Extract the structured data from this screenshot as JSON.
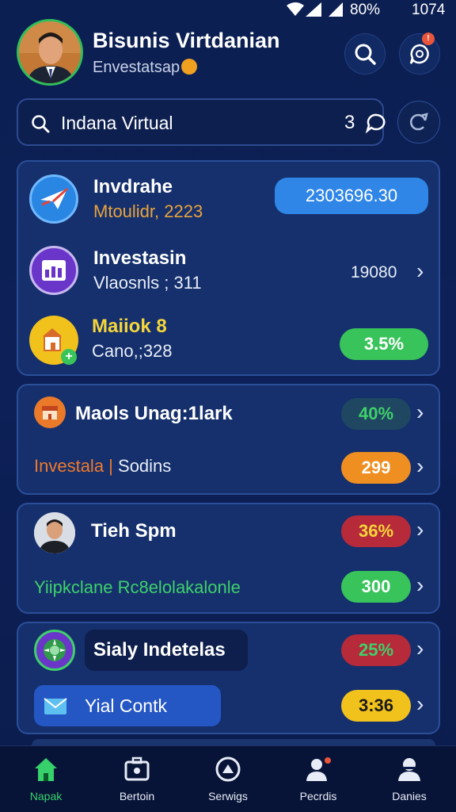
{
  "status_bar": {
    "battery": "80%",
    "time": "1074"
  },
  "header": {
    "title": "Bisunis Virtdanian",
    "subtitle": "Envestatsap",
    "notification_count": "!"
  },
  "search": {
    "text": "Indana Virtual",
    "count": "3"
  },
  "card1": {
    "rows": [
      {
        "title": "Invdrahe",
        "subtitle": "Mtoulidr, 2223",
        "value": "2303696.30",
        "icon": "paper-plane-icon"
      },
      {
        "title": "Investasin",
        "subtitle": "Vlaosnls ; 311",
        "value": "19080",
        "icon": "chart-icon"
      },
      {
        "title": "Maiiok 8",
        "subtitle": "Cano,;328",
        "value": "3.5%",
        "icon": "building-icon"
      }
    ]
  },
  "card2": {
    "title": "Maols Unag:1lark",
    "badge": "40%",
    "sub_orange": "Investala",
    "sub_white": "Sodins",
    "value": "299"
  },
  "card3": {
    "title": "Tieh Spm",
    "badge": "36%",
    "subtitle": "Yiipkclane Rc8elolakalonle",
    "value": "300"
  },
  "card4": {
    "title": "Sialy Indetelas",
    "badge": "25%",
    "button_label": "Yial Contk",
    "value": "3:36"
  },
  "nav": [
    {
      "label": "Napak",
      "icon": "home-icon",
      "active": true
    },
    {
      "label": "Bertoin",
      "icon": "briefcase-icon",
      "active": false
    },
    {
      "label": "Serwigs",
      "icon": "services-icon",
      "active": false
    },
    {
      "label": "Pecrdis",
      "icon": "person-icon",
      "active": false
    },
    {
      "label": "Danies",
      "icon": "profile-icon",
      "active": false
    }
  ],
  "colors": {
    "background": "#0c1f52",
    "card": "#15306d",
    "accent_blue": "#2f86e6",
    "green": "#38c45a",
    "orange": "#f0902a",
    "red": "#b62a3a",
    "yellow": "#f2c21c"
  }
}
